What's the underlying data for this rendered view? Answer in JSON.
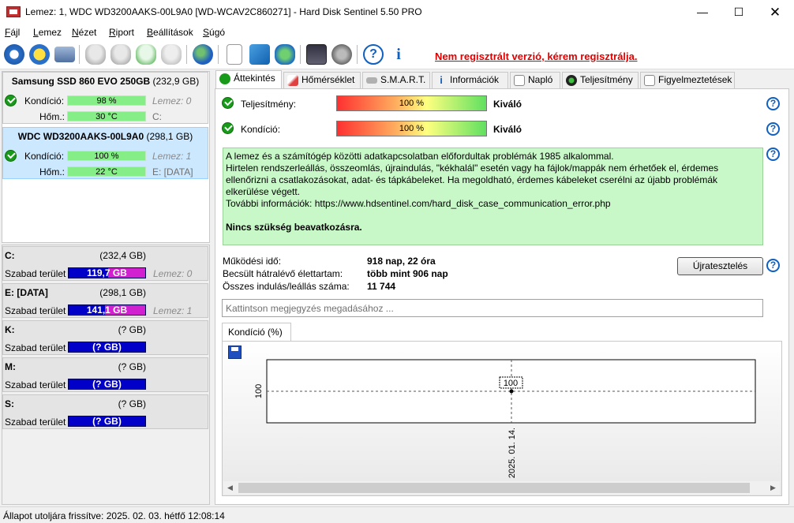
{
  "window": {
    "title": "Lemez: 1, WDC WD3200AAKS-00L9A0 [WD-WCAV2C860271]  -  Hard Disk Sentinel 5.50 PRO"
  },
  "menu": [
    {
      "label": "Fájl",
      "u": "F",
      "rest": "ájl"
    },
    {
      "label": "Lemez",
      "u": "L",
      "rest": "emez"
    },
    {
      "label": "Nézet",
      "u": "N",
      "rest": "ézet"
    },
    {
      "label": "Riport",
      "u": "R",
      "rest": "iport"
    },
    {
      "label": "Beállítások",
      "u": "B",
      "rest": "eállítások"
    },
    {
      "label": "Súgó",
      "u": "S",
      "rest": "úgó"
    }
  ],
  "toolbar": {
    "register_text": "Nem regisztrált verzió, kérem regisztrálja."
  },
  "disks": [
    {
      "name_bold": "Samsung SSD 860 EVO 250GB",
      "size": "(232,9 GB)",
      "cond_label": "Kondíció:",
      "cond_val": "98 %",
      "cond_pct": 98,
      "temp_label": "Hőm.:",
      "temp_val": "30 °C",
      "grey": "Lemez: 0",
      "drive": "C:"
    },
    {
      "name_bold": "WDC WD3200AAKS-00L9A0",
      "size": "(298,1 GB)",
      "cond_label": "Kondíció:",
      "cond_val": "100 %",
      "cond_pct": 100,
      "temp_label": "Hőm.:",
      "temp_val": "22 °C",
      "grey": "Lemez: 1",
      "drive": "E: [DATA]"
    }
  ],
  "volumes": [
    {
      "name": "C:",
      "size": "(232,4 GB)",
      "free_label": "Szabad terület",
      "free_val": "119,7 GB",
      "used_frac": 0.485,
      "grey": "Lemez: 0"
    },
    {
      "name": "E: [DATA]",
      "size": "(298,1 GB)",
      "free_label": "Szabad terület",
      "free_val": "141,1 GB",
      "used_frac": 0.527,
      "grey": "Lemez: 1"
    },
    {
      "name": "K:",
      "size": "(? GB)",
      "free_label": "Szabad terület",
      "free_val": "(? GB)",
      "used_frac": 0,
      "grey": ""
    },
    {
      "name": "M:",
      "size": "(? GB)",
      "free_label": "Szabad terület",
      "free_val": "(? GB)",
      "used_frac": 0,
      "grey": ""
    },
    {
      "name": "S:",
      "size": "(? GB)",
      "free_label": "Szabad terület",
      "free_val": "(? GB)",
      "used_frac": 0,
      "grey": ""
    }
  ],
  "tabs": [
    "Áttekintés",
    "Hőmérséklet",
    "S.M.A.R.T.",
    "Információk",
    "Napló",
    "Teljesítmény",
    "Figyelmeztetések"
  ],
  "overview": {
    "perf_label": "Teljesítmény:",
    "perf_val": "100 %",
    "perf_pct": 100,
    "perf_rating": "Kiváló",
    "cond_label": "Kondíció:",
    "cond_val": "100 %",
    "cond_pct": 100,
    "cond_rating": "Kiváló",
    "msg_lines": [
      "A lemez és a számítógép közötti adatkapcsolatban előfordultak problémák 1985 alkalommal.",
      "Hirtelen rendszerleállás, összeomlás, újraindulás, \"kékhalál\" esetén vagy ha fájlok/mappák nem érhetőek el, érdemes ellenőrizni a csatlakozásokat, adat- és tápkábeleket. Ha megoldható, érdemes kábeleket cserélni az újabb problémák elkerülése végett.",
      "További információk: https://www.hdsentinel.com/hard_disk_case_communication_error.php"
    ],
    "msg_bold": "Nincs szükség beavatkozásra.",
    "stats": [
      {
        "label": "Működési idő:",
        "value": "918 nap, 22 óra"
      },
      {
        "label": "Becsült hátralévő élettartam:",
        "value": "több mint 906 nap"
      },
      {
        "label": "Összes indulás/leállás száma:",
        "value": "11 744"
      }
    ],
    "reset_label": "Újratesztelés",
    "note_placeholder": "Kattintson megjegyzés megadásához ..."
  },
  "chart_tab": "Kondíció  (%)",
  "chart_data": {
    "type": "line",
    "x": [
      "2025. 01. 14."
    ],
    "values": [
      100
    ],
    "ylabel": "",
    "ytick": "100",
    "point_label": "100",
    "ylim": [
      0,
      200
    ]
  },
  "status": {
    "text": "Állapot utoljára frissítve: 2025. 02. 03. hétfő 12:08:14"
  },
  "colors": {
    "register": "#e00000",
    "ok": "#1a9a1a",
    "message_bg": "#c8f8c8",
    "volume_free": "#0000c8",
    "volume_used": "#d020d0"
  }
}
